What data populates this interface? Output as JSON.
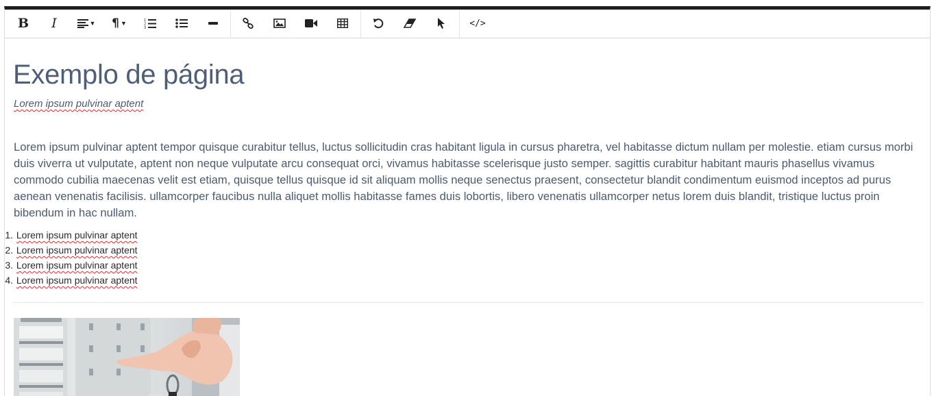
{
  "toolbar": {
    "buttons": [
      {
        "name": "bold",
        "label": "B"
      },
      {
        "name": "italic",
        "label": "I"
      },
      {
        "name": "paragraph",
        "label": "¶"
      }
    ],
    "icons": [
      "bold-icon",
      "italic-icon",
      "align-icon",
      "paragraph-icon",
      "ordered-list-icon",
      "unordered-list-icon",
      "horizontal-rule-icon",
      "link-icon",
      "image-icon",
      "video-icon",
      "table-icon",
      "undo-icon",
      "eraser-icon",
      "cursor-icon",
      "code-icon"
    ],
    "code_label": "</>"
  },
  "document": {
    "title": "Exemplo de página",
    "subtitle": "Lorem ipsum pulvinar aptent",
    "paragraph": "Lorem ipsum pulvinar aptent tempor quisque curabitur tellus, luctus sollicitudin cras habitant ligula in cursus pharetra, vel habitasse dictum nullam per molestie. etiam cursus morbi duis viverra ut vulputate, aptent non neque vulputate arcu consequat orci, vivamus habitasse scelerisque justo semper. sagittis curabitur habitant mauris phasellus vivamus commodo cubilia maecenas velit est etiam, quisque tellus quisque id sit aliquam mollis neque senectus praesent, consectetur blandit condimentum euismod inceptos ad purus aenean venenatis facilisis. ullamcorper faucibus nulla aliquet mollis habitasse fames duis lobortis, libero venenatis ullamcorper netus lorem duis blandit, tristique luctus proin bibendum in hac nullam.",
    "list": [
      {
        "num": "1.",
        "text": "Lorem ipsum pulvinar aptent"
      },
      {
        "num": "2.",
        "text": "Lorem ipsum pulvinar aptent"
      },
      {
        "num": "3.",
        "text": "Lorem ipsum pulvinar aptent"
      },
      {
        "num": "4.",
        "text": "Lorem ipsum pulvinar aptent"
      }
    ]
  },
  "colors": {
    "text": "#4b5a70",
    "title": "#4f5e77",
    "border_top": "#1e1e1e",
    "spellcheck": "#d9302c"
  }
}
